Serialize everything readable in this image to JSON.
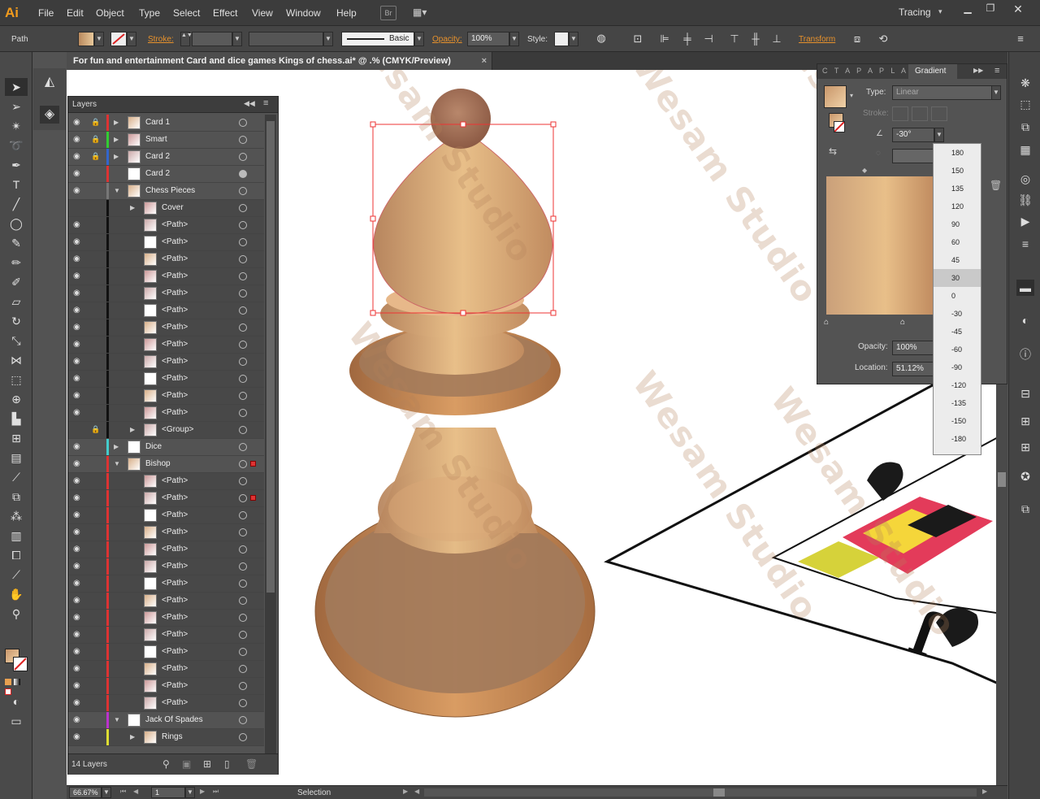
{
  "app": {
    "logo": "Ai"
  },
  "menu": [
    "File",
    "Edit",
    "Object",
    "Type",
    "Select",
    "Effect",
    "View",
    "Window",
    "Help"
  ],
  "menu_extra": {
    "br_label": "Br",
    "workspace": "Tracing"
  },
  "control": {
    "selection_type": "Path",
    "stroke_label": "Stroke:",
    "brush_label": "Basic",
    "opacity_label": "Opacity:",
    "opacity_value": "100%",
    "style_label": "Style:",
    "transform_label": "Transform"
  },
  "document": {
    "tab_title": "For fun and entertainment Card and dice games Kings of chess.ai* @ .% (CMYK/Preview)",
    "close": "×"
  },
  "layers": {
    "title": "Layers",
    "count_label": "14 Layers",
    "rows": [
      {
        "name": "Card 1",
        "color": "#d33",
        "indent": 0,
        "expand": "▶",
        "lock": true,
        "eye": true
      },
      {
        "name": "Smart",
        "color": "#3c3",
        "indent": 0,
        "expand": "▶",
        "lock": true,
        "eye": true
      },
      {
        "name": "Card 2",
        "color": "#36c",
        "indent": 0,
        "expand": "▶",
        "lock": true,
        "eye": true
      },
      {
        "name": "Card 2",
        "color": "#d33",
        "indent": 0,
        "expand": "",
        "lock": false,
        "eye": true
      },
      {
        "name": "Chess Pieces",
        "color": "#777",
        "indent": 0,
        "expand": "▼",
        "lock": false,
        "eye": true
      },
      {
        "name": "Cover",
        "color": "#111",
        "indent": 1,
        "expand": "▶",
        "lock": false,
        "eye": false
      },
      {
        "name": "<Path>",
        "color": "#111",
        "indent": 1,
        "expand": "",
        "lock": false,
        "eye": true
      },
      {
        "name": "<Path>",
        "color": "#111",
        "indent": 1,
        "expand": "",
        "lock": false,
        "eye": true
      },
      {
        "name": "<Path>",
        "color": "#111",
        "indent": 1,
        "expand": "",
        "lock": false,
        "eye": true
      },
      {
        "name": "<Path>",
        "color": "#111",
        "indent": 1,
        "expand": "",
        "lock": false,
        "eye": true
      },
      {
        "name": "<Path>",
        "color": "#111",
        "indent": 1,
        "expand": "",
        "lock": false,
        "eye": true
      },
      {
        "name": "<Path>",
        "color": "#111",
        "indent": 1,
        "expand": "",
        "lock": false,
        "eye": true
      },
      {
        "name": "<Path>",
        "color": "#111",
        "indent": 1,
        "expand": "",
        "lock": false,
        "eye": true
      },
      {
        "name": "<Path>",
        "color": "#111",
        "indent": 1,
        "expand": "",
        "lock": false,
        "eye": true
      },
      {
        "name": "<Path>",
        "color": "#111",
        "indent": 1,
        "expand": "",
        "lock": false,
        "eye": true
      },
      {
        "name": "<Path>",
        "color": "#111",
        "indent": 1,
        "expand": "",
        "lock": false,
        "eye": true
      },
      {
        "name": "<Path>",
        "color": "#111",
        "indent": 1,
        "expand": "",
        "lock": false,
        "eye": true
      },
      {
        "name": "<Path>",
        "color": "#111",
        "indent": 1,
        "expand": "",
        "lock": false,
        "eye": true
      },
      {
        "name": "<Group>",
        "color": "#111",
        "indent": 1,
        "expand": "▶",
        "lock": true,
        "eye": false
      },
      {
        "name": "Dice",
        "color": "#4cc",
        "indent": 0,
        "expand": "▶",
        "lock": false,
        "eye": true
      },
      {
        "name": "Bishop",
        "color": "#d33",
        "indent": 0,
        "expand": "▼",
        "lock": false,
        "eye": true
      },
      {
        "name": "<Path>",
        "color": "#d33",
        "indent": 1,
        "expand": "",
        "lock": false,
        "eye": true
      },
      {
        "name": "<Path>",
        "color": "#d33",
        "indent": 1,
        "expand": "",
        "lock": false,
        "eye": true
      },
      {
        "name": "<Path>",
        "color": "#d33",
        "indent": 1,
        "expand": "",
        "lock": false,
        "eye": true
      },
      {
        "name": "<Path>",
        "color": "#d33",
        "indent": 1,
        "expand": "",
        "lock": false,
        "eye": true
      },
      {
        "name": "<Path>",
        "color": "#d33",
        "indent": 1,
        "expand": "",
        "lock": false,
        "eye": true
      },
      {
        "name": "<Path>",
        "color": "#d33",
        "indent": 1,
        "expand": "",
        "lock": false,
        "eye": true
      },
      {
        "name": "<Path>",
        "color": "#d33",
        "indent": 1,
        "expand": "",
        "lock": false,
        "eye": true
      },
      {
        "name": "<Path>",
        "color": "#d33",
        "indent": 1,
        "expand": "",
        "lock": false,
        "eye": true
      },
      {
        "name": "<Path>",
        "color": "#d33",
        "indent": 1,
        "expand": "",
        "lock": false,
        "eye": true
      },
      {
        "name": "<Path>",
        "color": "#d33",
        "indent": 1,
        "expand": "",
        "lock": false,
        "eye": true
      },
      {
        "name": "<Path>",
        "color": "#d33",
        "indent": 1,
        "expand": "",
        "lock": false,
        "eye": true
      },
      {
        "name": "<Path>",
        "color": "#d33",
        "indent": 1,
        "expand": "",
        "lock": false,
        "eye": true
      },
      {
        "name": "<Path>",
        "color": "#d33",
        "indent": 1,
        "expand": "",
        "lock": false,
        "eye": true
      },
      {
        "name": "<Path>",
        "color": "#d33",
        "indent": 1,
        "expand": "",
        "lock": false,
        "eye": true
      },
      {
        "name": "Jack Of Spades",
        "color": "#b3c",
        "indent": 0,
        "expand": "▼",
        "lock": false,
        "eye": true
      },
      {
        "name": "Rings",
        "color": "#dd3",
        "indent": 1,
        "expand": "▶",
        "lock": false,
        "eye": true
      }
    ]
  },
  "gradient": {
    "tab_label": "Gradient",
    "collapsed_tabs": "C T A P A P L A S",
    "type_label": "Type:",
    "type_value": "Linear",
    "stroke_label": "Stroke:",
    "angle_value": "-30°",
    "opacity_label": "Opacity:",
    "opacity_value": "100%",
    "location_label": "Location:",
    "location_value": "51.12%",
    "angle_options": [
      "180",
      "150",
      "135",
      "120",
      "90",
      "60",
      "45",
      "30",
      "0",
      "-30",
      "-45",
      "-60",
      "-90",
      "-120",
      "-135",
      "-150",
      "-180"
    ],
    "highlighted": "30"
  },
  "status": {
    "zoom": "66.67%",
    "page": "1",
    "tool": "Selection"
  },
  "watermark": "Wesam Studio"
}
